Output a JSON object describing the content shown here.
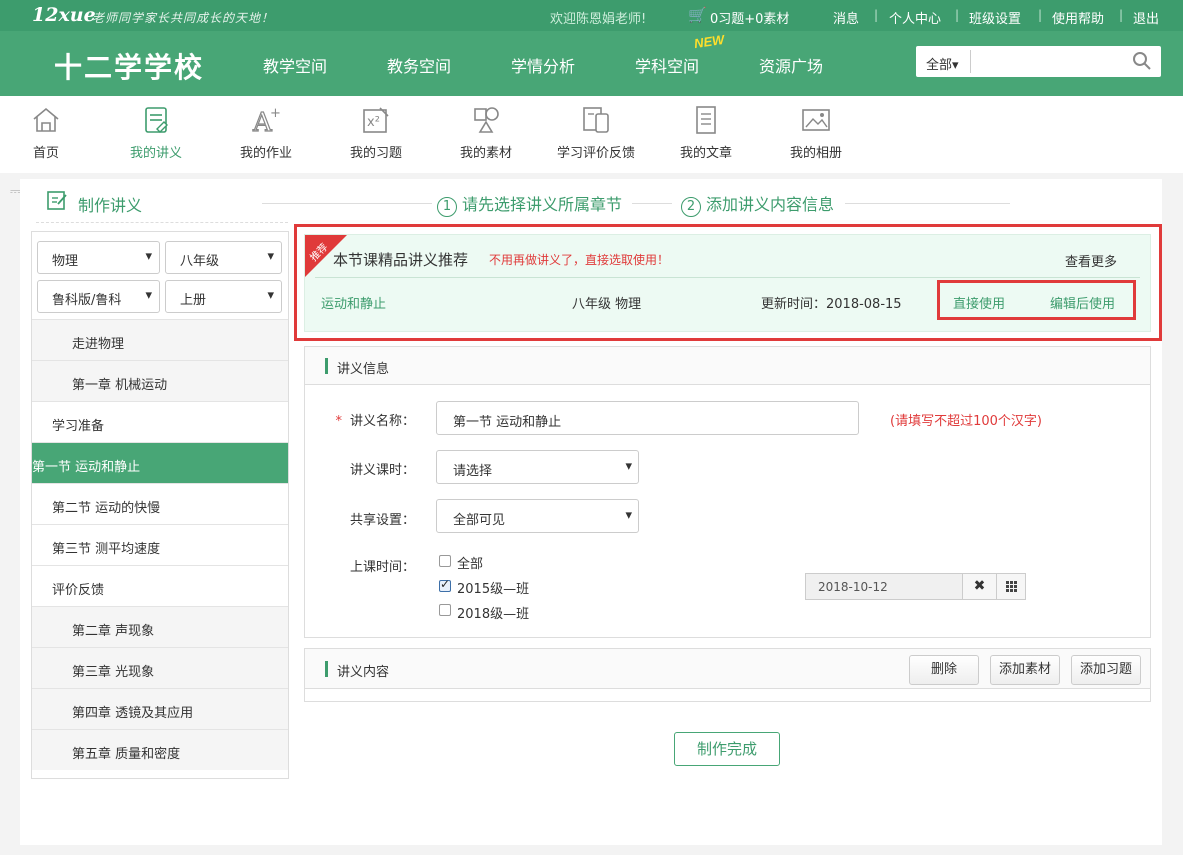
{
  "topbar": {
    "logo": "12xue",
    "slogan": "老师同学家长共同成长的天地！",
    "welcome": "欢迎陈恩娟老师!",
    "basket_count": "0习题+0素材",
    "links": [
      "消息",
      "个人中心",
      "班级设置",
      "使用帮助",
      "退出"
    ]
  },
  "nav": {
    "brand": "十二学学校",
    "items": [
      "教学空间",
      "教务空间",
      "学情分析",
      "学科空间",
      "资源广场"
    ],
    "new_badge": "NEW",
    "search": {
      "category": "全部",
      "placeholder": ""
    }
  },
  "toolbar": {
    "items": [
      "首页",
      "我的讲义",
      "我的作业",
      "我的习题",
      "我的素材",
      "学习评价反馈",
      "我的文章",
      "我的相册"
    ]
  },
  "page": {
    "title": "制作讲义",
    "steps": [
      {
        "num": "1",
        "label": "请先选择讲义所属章节"
      },
      {
        "num": "2",
        "label": "添加讲义内容信息"
      }
    ]
  },
  "sidebar": {
    "subject": "物理",
    "grade": "八年级",
    "edition": "鲁科版/鲁科",
    "volume": "上册",
    "tree": [
      {
        "label": "走进物理",
        "type": "sub"
      },
      {
        "label": "第一章 机械运动",
        "type": "sub"
      },
      {
        "label": "学习准备",
        "type": "lvl"
      },
      {
        "label": "第一节 运动和静止",
        "type": "cur"
      },
      {
        "label": "第二节 运动的快慢",
        "type": "lvl"
      },
      {
        "label": "第三节 测平均速度",
        "type": "lvl"
      },
      {
        "label": "评价反馈",
        "type": "lvl"
      },
      {
        "label": "第二章 声现象",
        "type": "sub"
      },
      {
        "label": "第三章 光现象",
        "type": "sub"
      },
      {
        "label": "第四章 透镜及其应用",
        "type": "sub"
      },
      {
        "label": "第五章 质量和密度",
        "type": "sub"
      }
    ]
  },
  "recommend": {
    "ribbon": "推荐",
    "title": "本节课精品讲义推荐",
    "hint": "不用再做讲义了，直接选取使用！",
    "more": "查看更多",
    "lesson": "运动和静止",
    "grade_subject": "八年级 物理",
    "updated": "更新时间：2018-08-15",
    "use_direct": "直接使用",
    "use_edit": "编辑后使用"
  },
  "info": {
    "header": "讲义信息",
    "name_label": "讲义名称：",
    "name_value": "第一节 运动和静止",
    "name_hint": "(请填写不超过100个汉字)",
    "hours_label": "讲义课时：",
    "hours_value": "请选择",
    "share_label": "共享设置：",
    "share_value": "全部可见",
    "time_label": "上课时间：",
    "classes": [
      {
        "label": "全部",
        "checked": false
      },
      {
        "label": "2015级—班",
        "checked": true
      },
      {
        "label": "2018级—班",
        "checked": false
      }
    ],
    "date_value": "2018-10-12",
    "required_mark": "*"
  },
  "content": {
    "header": "讲义内容",
    "buttons": [
      "删除",
      "添加素材",
      "添加习题"
    ]
  },
  "finish_label": "制作完成",
  "colors": {
    "brand": "#48a676",
    "brand_dark": "#3d9c6d",
    "alert": "#e03a3a",
    "recommend_bg": "#edfaf3"
  }
}
